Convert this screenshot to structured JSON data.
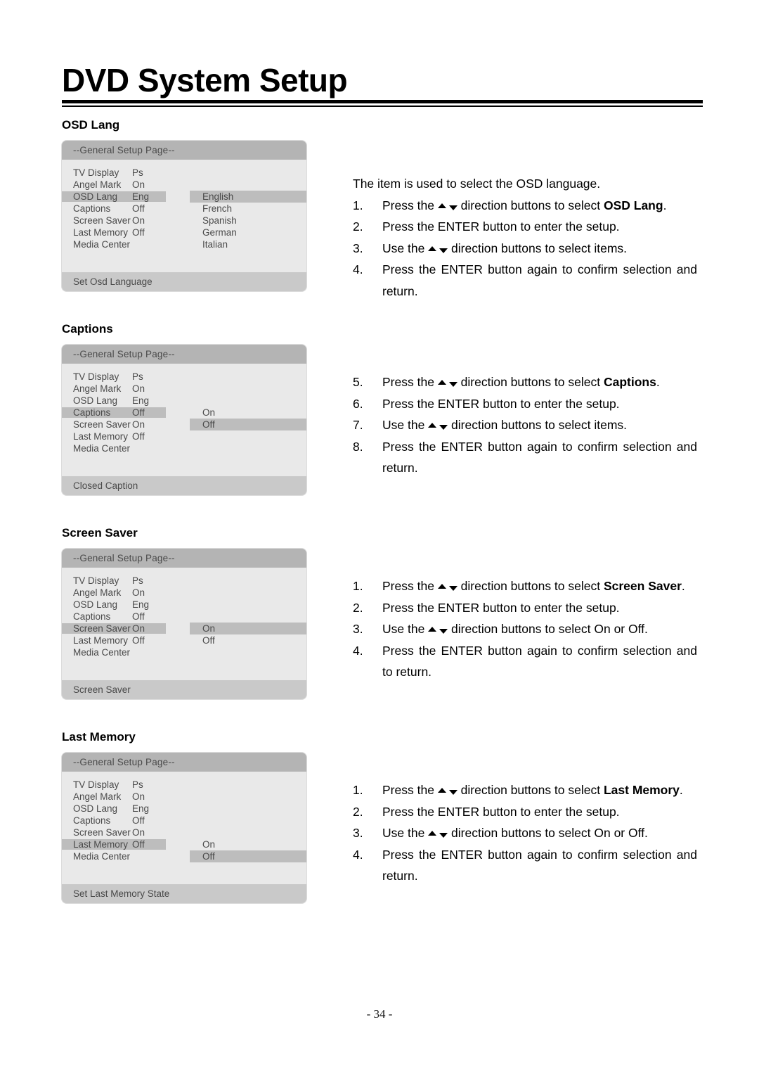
{
  "document": {
    "title": "DVD System Setup",
    "page_number": "- 34 -"
  },
  "osd_common": {
    "header": "--General Setup Page--",
    "menu_labels": [
      "TV Display",
      "Angel Mark",
      "OSD Lang",
      "Captions",
      "Screen Saver",
      "Last Memory",
      "Media Center"
    ],
    "menu_values": [
      "Ps",
      "On",
      "Eng",
      "Off",
      "On",
      "Off",
      ""
    ]
  },
  "sections": [
    {
      "id": "osd-lang",
      "heading": "OSD Lang",
      "osd": {
        "header": "--General Setup Page--",
        "footer": "Set Osd Language",
        "rows": [
          {
            "label": "TV Display",
            "value": "Ps",
            "selected": false
          },
          {
            "label": "Angel Mark",
            "value": "On",
            "selected": false
          },
          {
            "label": "OSD Lang",
            "value": "Eng",
            "selected": true
          },
          {
            "label": "Captions",
            "value": "Off",
            "selected": false
          },
          {
            "label": "Screen Saver",
            "value": "On",
            "selected": false
          },
          {
            "label": "Last Memory",
            "value": "Off",
            "selected": false
          },
          {
            "label": "Media Center",
            "value": "",
            "selected": false
          }
        ],
        "options": [
          {
            "label": "English",
            "selected": true
          },
          {
            "label": "French",
            "selected": false
          },
          {
            "label": "Spanish",
            "selected": false
          },
          {
            "label": "German",
            "selected": false
          },
          {
            "label": "Italian",
            "selected": false
          }
        ],
        "options_offset_rows": 2
      },
      "lead": "The item is used to select the OSD language.",
      "steps": [
        {
          "num": "1.",
          "before": "Press the ",
          "arrows": true,
          "after_plain": " direction buttons to select ",
          "bold": "OSD Lang",
          "tail": "."
        },
        {
          "num": "2.",
          "before": "Press the ENTER button to enter the setup.",
          "arrows": false,
          "after_plain": "",
          "bold": "",
          "tail": ""
        },
        {
          "num": "3.",
          "before": "Use the ",
          "arrows": true,
          "after_plain": " direction buttons to select items.",
          "bold": "",
          "tail": ""
        },
        {
          "num": "4.",
          "before": "Press the ENTER button again to confirm selection and return.",
          "arrows": false,
          "after_plain": "",
          "bold": "",
          "tail": ""
        }
      ]
    },
    {
      "id": "captions",
      "heading": "Captions",
      "osd": {
        "header": "--General Setup Page--",
        "footer": "Closed Caption",
        "rows": [
          {
            "label": "TV Display",
            "value": "Ps",
            "selected": false
          },
          {
            "label": "Angel Mark",
            "value": "On",
            "selected": false
          },
          {
            "label": "OSD Lang",
            "value": "Eng",
            "selected": false
          },
          {
            "label": "Captions",
            "value": "Off",
            "selected": true
          },
          {
            "label": "Screen Saver",
            "value": "On",
            "selected": false
          },
          {
            "label": "Last Memory",
            "value": "Off",
            "selected": false
          },
          {
            "label": "Media Center",
            "value": "",
            "selected": false
          }
        ],
        "options": [
          {
            "label": "On",
            "selected": false
          },
          {
            "label": "Off",
            "selected": true
          }
        ],
        "options_offset_rows": 3
      },
      "lead": "",
      "steps": [
        {
          "num": "5.",
          "before": "Press the ",
          "arrows": true,
          "after_plain": " direction buttons to select ",
          "bold": "Captions",
          "tail": "."
        },
        {
          "num": "6.",
          "before": "Press the ENTER button to enter the setup.",
          "arrows": false,
          "after_plain": "",
          "bold": "",
          "tail": ""
        },
        {
          "num": "7.",
          "before": "Use the ",
          "arrows": true,
          "after_plain": " direction buttons to select items.",
          "bold": "",
          "tail": ""
        },
        {
          "num": "8.",
          "before": "Press the ENTER button again to confirm selection and return.",
          "arrows": false,
          "after_plain": "",
          "bold": "",
          "tail": ""
        }
      ]
    },
    {
      "id": "screen-saver",
      "heading": "Screen Saver",
      "osd": {
        "header": "--General Setup Page--",
        "footer": "Screen Saver",
        "rows": [
          {
            "label": "TV Display",
            "value": "Ps",
            "selected": false
          },
          {
            "label": "Angel Mark",
            "value": "On",
            "selected": false
          },
          {
            "label": "OSD Lang",
            "value": "Eng",
            "selected": false
          },
          {
            "label": "Captions",
            "value": "Off",
            "selected": false
          },
          {
            "label": "Screen Saver",
            "value": "On",
            "selected": true
          },
          {
            "label": "Last Memory",
            "value": "Off",
            "selected": false
          },
          {
            "label": "Media Center",
            "value": "",
            "selected": false
          }
        ],
        "options": [
          {
            "label": "On",
            "selected": true
          },
          {
            "label": "Off",
            "selected": false
          }
        ],
        "options_offset_rows": 4
      },
      "lead": "",
      "steps": [
        {
          "num": "1.",
          "before": "Press the ",
          "arrows": true,
          "after_plain": " direction buttons to select ",
          "bold": "Screen Saver",
          "tail": "."
        },
        {
          "num": "2.",
          "before": "Press the ENTER button to enter the setup.",
          "arrows": false,
          "after_plain": "",
          "bold": "",
          "tail": ""
        },
        {
          "num": "3.",
          "before": "Use the ",
          "arrows": true,
          "after_plain": " direction buttons to select On or Off.",
          "bold": "",
          "tail": ""
        },
        {
          "num": "4.",
          "before": "Press the ENTER button again to confirm selection and to return.",
          "arrows": false,
          "after_plain": "",
          "bold": "",
          "tail": ""
        }
      ]
    },
    {
      "id": "last-memory",
      "heading": "Last Memory",
      "osd": {
        "header": "--General Setup Page--",
        "footer": "Set Last Memory State",
        "rows": [
          {
            "label": "TV Display",
            "value": "Ps",
            "selected": false
          },
          {
            "label": "Angel Mark",
            "value": "On",
            "selected": false
          },
          {
            "label": "OSD Lang",
            "value": "Eng",
            "selected": false
          },
          {
            "label": "Captions",
            "value": "Off",
            "selected": false
          },
          {
            "label": "Screen Saver",
            "value": "On",
            "selected": false
          },
          {
            "label": "Last Memory",
            "value": "Off",
            "selected": true
          },
          {
            "label": "Media Center",
            "value": "",
            "selected": false
          }
        ],
        "options": [
          {
            "label": "On",
            "selected": false
          },
          {
            "label": "Off",
            "selected": true
          }
        ],
        "options_offset_rows": 5
      },
      "lead": "",
      "steps": [
        {
          "num": "1.",
          "before": "Press the ",
          "arrows": true,
          "after_plain": " direction buttons to select ",
          "bold": "Last Memory",
          "tail": "."
        },
        {
          "num": "2.",
          "before": "Press the ENTER button to enter the setup.",
          "arrows": false,
          "after_plain": "",
          "bold": "",
          "tail": ""
        },
        {
          "num": "3.",
          "before": "Use the ",
          "arrows": true,
          "after_plain": " direction buttons to select On or Off.",
          "bold": "",
          "tail": ""
        },
        {
          "num": "4.",
          "before": "Press the ENTER button again to confirm selection and return.",
          "arrows": false,
          "after_plain": "",
          "bold": "",
          "tail": ""
        }
      ]
    }
  ],
  "colors": {
    "osd_header_bg": "#b4b4b4",
    "osd_body_bg": "#e9e9e9",
    "osd_footer_bg": "#c9c9c9",
    "osd_highlight": "#bdbdbd",
    "osd_text": "#4a4a4a",
    "rule": "#000000"
  }
}
